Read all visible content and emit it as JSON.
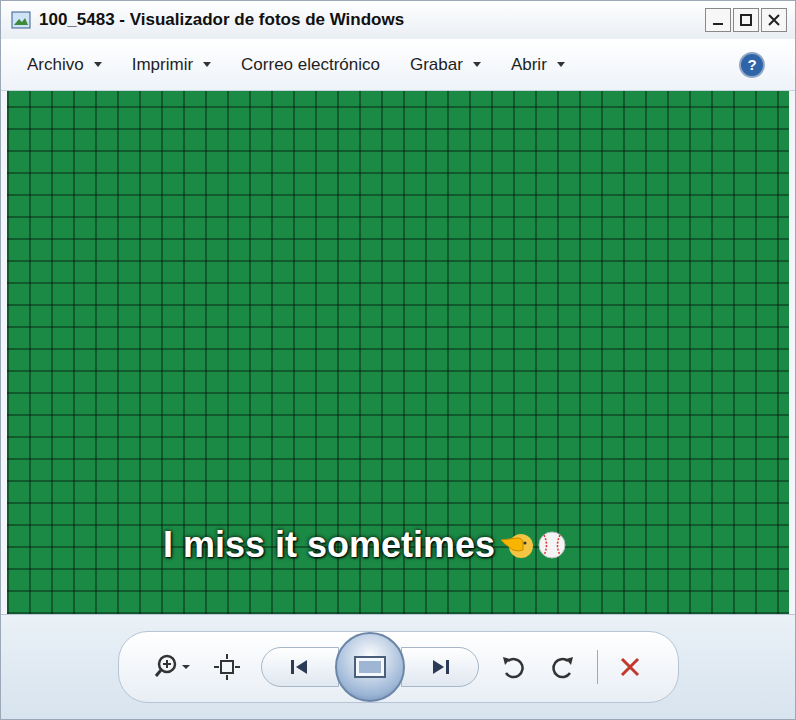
{
  "window": {
    "title": "100_5483 - Visualizador de fotos de Windows"
  },
  "menu": [
    {
      "label": "Archivo",
      "dropdown": true
    },
    {
      "label": "Imprimir",
      "dropdown": true
    },
    {
      "label": "Correo electrónico",
      "dropdown": false
    },
    {
      "label": "Grabar",
      "dropdown": true
    },
    {
      "label": "Abrir",
      "dropdown": true
    }
  ],
  "help": "?",
  "photo": {
    "caption": "I miss it sometimes"
  },
  "toolbar": [
    {
      "kind": "zoom"
    },
    {
      "kind": "fit"
    },
    {
      "kind": "previous"
    },
    {
      "kind": "slideshow"
    },
    {
      "kind": "next"
    },
    {
      "kind": "rotate-left"
    },
    {
      "kind": "rotate-right"
    },
    {
      "kind": "separator"
    },
    {
      "kind": "delete"
    }
  ]
}
